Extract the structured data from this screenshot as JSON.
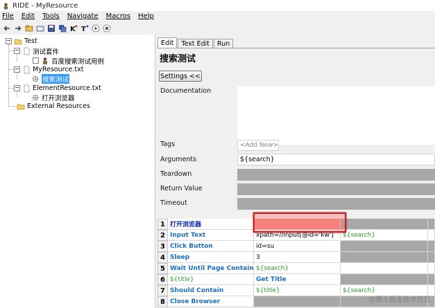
{
  "window": {
    "title": "RIDE - MyResource"
  },
  "menu": [
    "File",
    "Edit",
    "Tools",
    "Navigate",
    "Macros",
    "Help"
  ],
  "toolbar_icons": [
    "back-arrow-icon",
    "forward-arrow-icon",
    "open-folder-icon",
    "open-directory-icon",
    "save-icon",
    "save-all-icon",
    "search-keywords-icon",
    "search-tests-icon",
    "run-icon",
    "stop-icon"
  ],
  "tree": {
    "root": "Test",
    "suite": "测试套件",
    "testcase": "百度搜索测试用例",
    "resource1": "MyResource.txt",
    "keyword1": "搜索测试",
    "resource2": "ElementResource.txt",
    "keyword2": "打开浏览器",
    "external": "External Resources"
  },
  "tabs": [
    "Edit",
    "Text Edit",
    "Run"
  ],
  "editor": {
    "title": "搜索测试",
    "settings_button": "Settings <<",
    "documentation_label": "Documentation",
    "tags_label": "Tags",
    "tags_placeholder": "<Add New>",
    "arguments_label": "Arguments",
    "arguments_value": "${search}",
    "teardown_label": "Teardown",
    "return_label": "Return Value",
    "timeout_label": "Timeout"
  },
  "steps": [
    {
      "num": "1",
      "c1": "打开浏览器",
      "c2": "",
      "c3": ""
    },
    {
      "num": "2",
      "c1": "Input Text",
      "c2": "xpath=//input[@id='kw']",
      "c3": "${search}"
    },
    {
      "num": "3",
      "c1": "Click Button",
      "c2": "id=su",
      "c3": ""
    },
    {
      "num": "4",
      "c1": "Sleep",
      "c2": "3",
      "c3": ""
    },
    {
      "num": "5",
      "c1": "Wait Until Page Contains",
      "c2": "${search}",
      "c3": ""
    },
    {
      "num": "6",
      "c1": "${title}",
      "c2": "Get Title",
      "c3": ""
    },
    {
      "num": "7",
      "c1": "Should Contain",
      "c2": "${title}",
      "c3": "${search}"
    },
    {
      "num": "8",
      "c1": "Close Browser",
      "c2": "",
      "c3": ""
    }
  ],
  "watermark": "@稀土掘金技术社区"
}
